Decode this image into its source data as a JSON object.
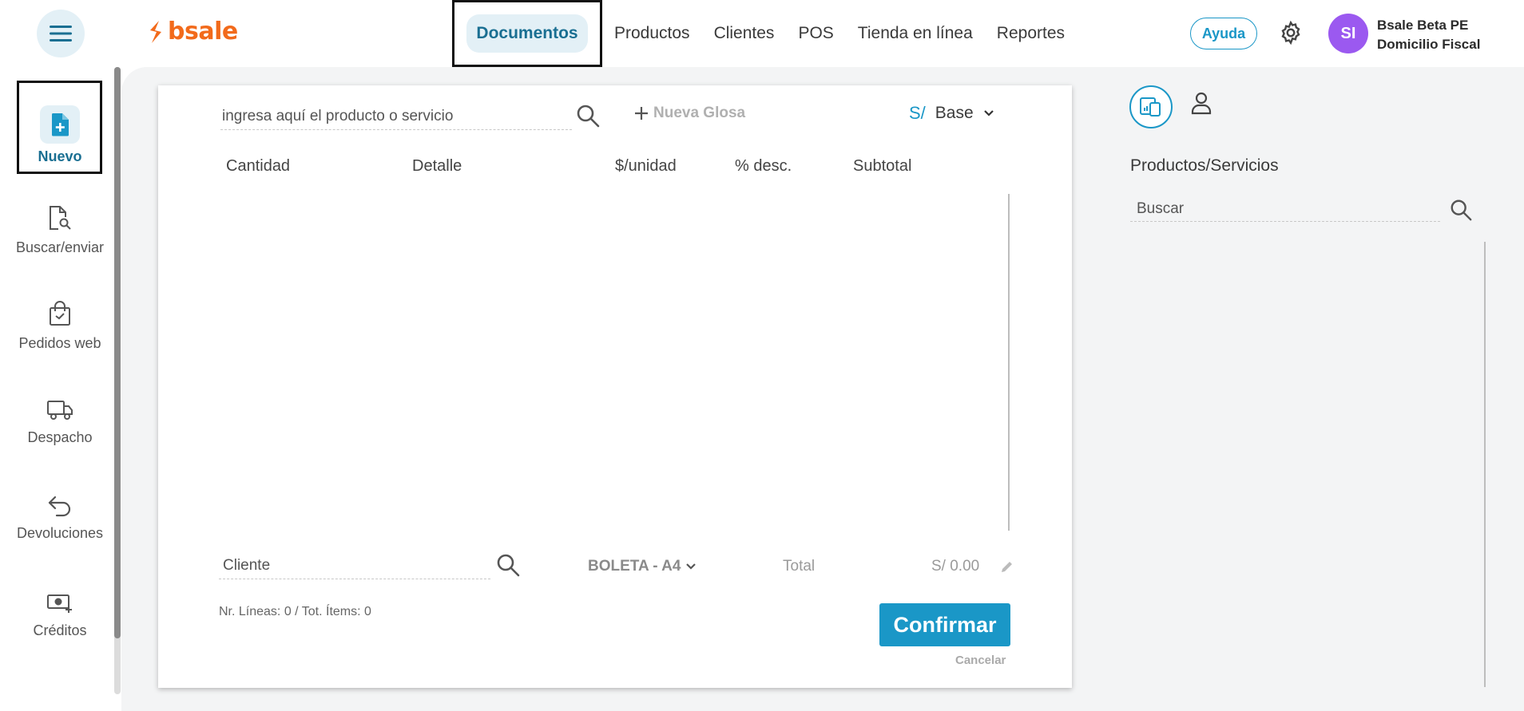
{
  "header": {
    "logo_text": "bsale",
    "nav": [
      {
        "label": "Documentos",
        "active": true
      },
      {
        "label": "Productos"
      },
      {
        "label": "Clientes"
      },
      {
        "label": "POS"
      },
      {
        "label": "Tienda en línea"
      },
      {
        "label": "Reportes"
      }
    ],
    "help_label": "Ayuda",
    "avatar_initials": "SI",
    "user_name": "Bsale Beta PE",
    "user_branch": "Domicilio Fiscal"
  },
  "sidebar": {
    "items": [
      {
        "label": "Nuevo",
        "icon": "new-document-icon",
        "active": true
      },
      {
        "label": "Buscar/enviar",
        "icon": "search-document-icon"
      },
      {
        "label": "Pedidos web",
        "icon": "shopping-bag-icon"
      },
      {
        "label": "Despacho",
        "icon": "truck-icon"
      },
      {
        "label": "Devoluciones",
        "icon": "return-arrow-icon"
      },
      {
        "label": "Créditos",
        "icon": "money-add-icon"
      }
    ]
  },
  "document": {
    "product_placeholder": "ingresa aquí el producto o servicio",
    "new_glosa_label": "Nueva Glosa",
    "currency_symbol": "S/",
    "price_list": "Base",
    "columns": [
      "Cantidad",
      "Detalle",
      "$/unidad",
      "% desc.",
      "Subtotal"
    ],
    "client_placeholder": "Cliente",
    "doc_type": "BOLETA - A4",
    "total_label": "Total",
    "total_value": "S/ 0.00",
    "counts": "Nr. Líneas: 0 / Tot. Ítems: 0",
    "confirm_label": "Confirmar",
    "cancel_label": "Cancelar"
  },
  "right_panel": {
    "title": "Productos/Servicios",
    "search_placeholder": "Buscar"
  },
  "colors": {
    "accent": "#1a97c7",
    "brand": "#f26a1b",
    "avatar": "#9b59f0",
    "active_bg": "#e3f0f6"
  }
}
